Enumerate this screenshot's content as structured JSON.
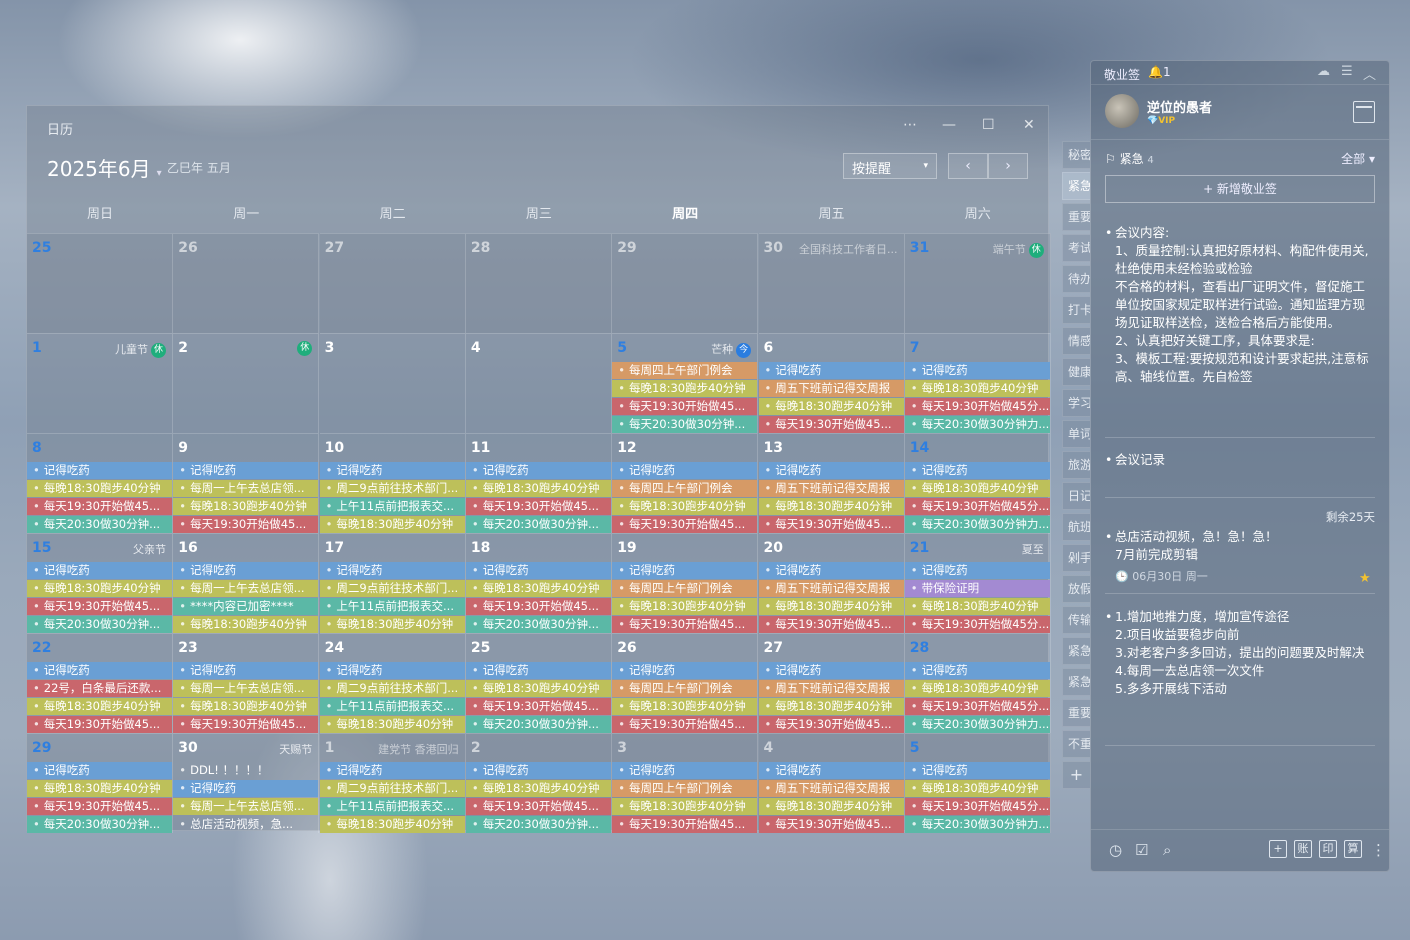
{
  "calendar": {
    "title": "日历",
    "controls": {
      "more": "⋯",
      "minimize": "—",
      "maximize": "☐",
      "close": "✕"
    },
    "month": "2025年6月",
    "month_caret": "▾",
    "lunar": "乙巳年 五月",
    "mode": "按提醒",
    "mode_caret": "▾",
    "prev": "‹",
    "next": "›",
    "weekdays": [
      "周日",
      "周一",
      "周二",
      "周三",
      "周四",
      "周五",
      "周六"
    ],
    "weeks": [
      [
        {
          "d": "25",
          "o": 1,
          "blue": 1
        },
        {
          "d": "26",
          "o": 1
        },
        {
          "d": "27",
          "o": 1
        },
        {
          "d": "28",
          "o": 1
        },
        {
          "d": "29",
          "o": 1
        },
        {
          "d": "30",
          "o": 1,
          "f": "全国科技工作者日..."
        },
        {
          "d": "31",
          "o": 1,
          "blue": 1,
          "f": "端午节",
          "b": "休",
          "bc": "g"
        }
      ],
      [
        {
          "d": "1",
          "blue": 1,
          "f": "儿童节",
          "b": "休",
          "bc": "g"
        },
        {
          "d": "2",
          "b": "休",
          "bc": "g"
        },
        {
          "d": "3"
        },
        {
          "d": "4"
        },
        {
          "d": "5",
          "blue": 1,
          "f": "芒种",
          "b": "今",
          "bc": "b",
          "ev": [
            [
              "每周四上午部门例会",
              "orange"
            ],
            [
              "每晚18:30跑步40分钟",
              "yellow"
            ],
            [
              "每天19:30开始做45...",
              "red"
            ],
            [
              "每天20:30做30分钟...",
              "teal"
            ]
          ]
        },
        {
          "d": "6",
          "ev": [
            [
              "记得吃药",
              "blue"
            ],
            [
              "周五下班前记得交周报",
              "orange"
            ],
            [
              "每晚18:30跑步40分钟",
              "yellow"
            ],
            [
              "每天19:30开始做45...",
              "red"
            ]
          ]
        },
        {
          "d": "7",
          "blue": 1,
          "ev": [
            [
              "记得吃药",
              "blue"
            ],
            [
              "每晚18:30跑步40分钟",
              "yellow"
            ],
            [
              "每天19:30开始做45分...",
              "red"
            ],
            [
              "每天20:30做30分钟力...",
              "teal"
            ]
          ]
        }
      ],
      [
        {
          "d": "8",
          "blue": 1,
          "ev": [
            [
              "记得吃药",
              "blue"
            ],
            [
              "每晚18:30跑步40分钟",
              "yellow"
            ],
            [
              "每天19:30开始做45...",
              "red"
            ],
            [
              "每天20:30做30分钟...",
              "teal"
            ]
          ]
        },
        {
          "d": "9",
          "ev": [
            [
              "记得吃药",
              "blue"
            ],
            [
              "每周一上午去总店领...",
              "yellow"
            ],
            [
              "每晚18:30跑步40分钟",
              "yellow"
            ],
            [
              "每天19:30开始做45...",
              "red"
            ]
          ]
        },
        {
          "d": "10",
          "ev": [
            [
              "记得吃药",
              "blue"
            ],
            [
              "周二9点前往技术部门...",
              "yellow"
            ],
            [
              "上午11点前把报表交...",
              "teal"
            ],
            [
              "每晚18:30跑步40分钟",
              "yellow"
            ]
          ]
        },
        {
          "d": "11",
          "ev": [
            [
              "记得吃药",
              "blue"
            ],
            [
              "每晚18:30跑步40分钟",
              "yellow"
            ],
            [
              "每天19:30开始做45...",
              "red"
            ],
            [
              "每天20:30做30分钟...",
              "teal"
            ]
          ]
        },
        {
          "d": "12",
          "ev": [
            [
              "记得吃药",
              "blue"
            ],
            [
              "每周四上午部门例会",
              "orange"
            ],
            [
              "每晚18:30跑步40分钟",
              "yellow"
            ],
            [
              "每天19:30开始做45...",
              "red"
            ]
          ]
        },
        {
          "d": "13",
          "ev": [
            [
              "记得吃药",
              "blue"
            ],
            [
              "周五下班前记得交周报",
              "orange"
            ],
            [
              "每晚18:30跑步40分钟",
              "yellow"
            ],
            [
              "每天19:30开始做45...",
              "red"
            ]
          ]
        },
        {
          "d": "14",
          "blue": 1,
          "ev": [
            [
              "记得吃药",
              "blue"
            ],
            [
              "每晚18:30跑步40分钟",
              "yellow"
            ],
            [
              "每天19:30开始做45分...",
              "red"
            ],
            [
              "每天20:30做30分钟力...",
              "teal"
            ]
          ]
        }
      ],
      [
        {
          "d": "15",
          "blue": 1,
          "f": "父亲节",
          "ev": [
            [
              "记得吃药",
              "blue"
            ],
            [
              "每晚18:30跑步40分钟",
              "yellow"
            ],
            [
              "每天19:30开始做45...",
              "red"
            ],
            [
              "每天20:30做30分钟...",
              "teal"
            ]
          ]
        },
        {
          "d": "16",
          "ev": [
            [
              "记得吃药",
              "blue"
            ],
            [
              "每周一上午去总店领...",
              "yellow"
            ],
            [
              "****内容已加密****",
              "teal"
            ],
            [
              "每晚18:30跑步40分钟",
              "yellow"
            ]
          ]
        },
        {
          "d": "17",
          "ev": [
            [
              "记得吃药",
              "blue"
            ],
            [
              "周二9点前往技术部门...",
              "yellow"
            ],
            [
              "上午11点前把报表交...",
              "teal"
            ],
            [
              "每晚18:30跑步40分钟",
              "yellow"
            ]
          ]
        },
        {
          "d": "18",
          "ev": [
            [
              "记得吃药",
              "blue"
            ],
            [
              "每晚18:30跑步40分钟",
              "yellow"
            ],
            [
              "每天19:30开始做45...",
              "red"
            ],
            [
              "每天20:30做30分钟...",
              "teal"
            ]
          ]
        },
        {
          "d": "19",
          "ev": [
            [
              "记得吃药",
              "blue"
            ],
            [
              "每周四上午部门例会",
              "orange"
            ],
            [
              "每晚18:30跑步40分钟",
              "yellow"
            ],
            [
              "每天19:30开始做45...",
              "red"
            ]
          ]
        },
        {
          "d": "20",
          "ev": [
            [
              "记得吃药",
              "blue"
            ],
            [
              "周五下班前记得交周报",
              "orange"
            ],
            [
              "每晚18:30跑步40分钟",
              "yellow"
            ],
            [
              "每天19:30开始做45...",
              "red"
            ]
          ]
        },
        {
          "d": "21",
          "blue": 1,
          "f": "夏至",
          "ev": [
            [
              "记得吃药",
              "blue"
            ],
            [
              "带保险证明",
              "purple"
            ],
            [
              "每晚18:30跑步40分钟",
              "yellow"
            ],
            [
              "每天19:30开始做45分...",
              "red"
            ]
          ]
        }
      ],
      [
        {
          "d": "22",
          "blue": 1,
          "ev": [
            [
              "记得吃药",
              "blue"
            ],
            [
              "22号，白条最后还款...",
              "red"
            ],
            [
              "每晚18:30跑步40分钟",
              "yellow"
            ],
            [
              "每天19:30开始做45...",
              "red"
            ]
          ]
        },
        {
          "d": "23",
          "ev": [
            [
              "记得吃药",
              "blue"
            ],
            [
              "每周一上午去总店领...",
              "yellow"
            ],
            [
              "每晚18:30跑步40分钟",
              "yellow"
            ],
            [
              "每天19:30开始做45...",
              "red"
            ]
          ]
        },
        {
          "d": "24",
          "ev": [
            [
              "记得吃药",
              "blue"
            ],
            [
              "周二9点前往技术部门...",
              "yellow"
            ],
            [
              "上午11点前把报表交...",
              "teal"
            ],
            [
              "每晚18:30跑步40分钟",
              "yellow"
            ]
          ]
        },
        {
          "d": "25",
          "ev": [
            [
              "记得吃药",
              "blue"
            ],
            [
              "每晚18:30跑步40分钟",
              "yellow"
            ],
            [
              "每天19:30开始做45...",
              "red"
            ],
            [
              "每天20:30做30分钟...",
              "teal"
            ]
          ]
        },
        {
          "d": "26",
          "ev": [
            [
              "记得吃药",
              "blue"
            ],
            [
              "每周四上午部门例会",
              "orange"
            ],
            [
              "每晚18:30跑步40分钟",
              "yellow"
            ],
            [
              "每天19:30开始做45...",
              "red"
            ]
          ]
        },
        {
          "d": "27",
          "ev": [
            [
              "记得吃药",
              "blue"
            ],
            [
              "周五下班前记得交周报",
              "orange"
            ],
            [
              "每晚18:30跑步40分钟",
              "yellow"
            ],
            [
              "每天19:30开始做45...",
              "red"
            ]
          ]
        },
        {
          "d": "28",
          "blue": 1,
          "ev": [
            [
              "记得吃药",
              "blue"
            ],
            [
              "每晚18:30跑步40分钟",
              "yellow"
            ],
            [
              "每天19:30开始做45分...",
              "red"
            ],
            [
              "每天20:30做30分钟力...",
              "teal"
            ]
          ]
        }
      ],
      [
        {
          "d": "29",
          "blue": 1,
          "ev": [
            [
              "记得吃药",
              "blue"
            ],
            [
              "每晚18:30跑步40分钟",
              "yellow"
            ],
            [
              "每天19:30开始做45...",
              "red"
            ],
            [
              "每天20:30做30分钟...",
              "teal"
            ]
          ]
        },
        {
          "d": "30",
          "f": "天赐节",
          "ev": [
            [
              "DDL! ！！！！",
              "none"
            ],
            [
              "记得吃药",
              "blue"
            ],
            [
              "每周一上午去总店领...",
              "yellow"
            ],
            [
              "总店活动视频，急...",
              "none"
            ]
          ]
        },
        {
          "d": "1",
          "o": 1,
          "f": "建党节 香港回归",
          "ev": [
            [
              "记得吃药",
              "blue"
            ],
            [
              "周二9点前往技术部门...",
              "yellow"
            ],
            [
              "上午11点前把报表交...",
              "teal"
            ],
            [
              "每晚18:30跑步40分钟",
              "yellow"
            ]
          ]
        },
        {
          "d": "2",
          "o": 1,
          "ev": [
            [
              "记得吃药",
              "blue"
            ],
            [
              "每晚18:30跑步40分钟",
              "yellow"
            ],
            [
              "每天19:30开始做45...",
              "red"
            ],
            [
              "每天20:30做30分钟...",
              "teal"
            ]
          ]
        },
        {
          "d": "3",
          "o": 1,
          "ev": [
            [
              "记得吃药",
              "blue"
            ],
            [
              "每周四上午部门例会",
              "orange"
            ],
            [
              "每晚18:30跑步40分钟",
              "yellow"
            ],
            [
              "每天19:30开始做45...",
              "red"
            ]
          ]
        },
        {
          "d": "4",
          "o": 1,
          "ev": [
            [
              "记得吃药",
              "blue"
            ],
            [
              "周五下班前记得交周报",
              "orange"
            ],
            [
              "每晚18:30跑步40分钟",
              "yellow"
            ],
            [
              "每天19:30开始做45...",
              "red"
            ]
          ]
        },
        {
          "d": "5",
          "o": 1,
          "blue": 1,
          "ev": [
            [
              "记得吃药",
              "blue"
            ],
            [
              "每晚18:30跑步40分钟",
              "yellow"
            ],
            [
              "每天19:30开始做45分...",
              "red"
            ],
            [
              "每天20:30做30分钟力...",
              "teal"
            ]
          ]
        }
      ]
    ]
  },
  "panel": {
    "app": "敬业签",
    "bell_count": "1",
    "user": "逆位的愚者",
    "vip": "💎VIP",
    "category": "紧急",
    "category_count": "4",
    "filter": "全部 ▾",
    "new_button": "+ 新增敬业签",
    "notes": [
      {
        "lines": [
          "会议内容:",
          "1、质量控制:认真把好原材料、构配件使用关,杜绝使用未经检验或检验",
          "不合格的材料，查看出厂证明文件，督促施工单位按国家规定取样进行试验。通知监理方现场见证取样送检，送检合格后方能使用。",
          "2、认真把好关键工序，具体要求是:",
          "3、模板工程:要按规范和设计要求起拱,注意标高、轴线位置。先自检签"
        ]
      },
      {
        "lines": [
          "会议记录"
        ]
      },
      {
        "lines": [
          "总店活动视频，急！急！急！",
          "7月前完成剪辑"
        ],
        "date": "06月30日 周一"
      },
      {
        "lines": [
          "1.增加地推力度，增加宣传途径",
          "2.项目收益要稳步向前",
          "3.对老客户多多回访，提出的问题要及时解决",
          "4.每周一去总店领一次文件",
          "5.多多开展线下活动"
        ]
      }
    ],
    "remaining": "剩余25天",
    "footer_buttons": [
      "账",
      "印",
      "算"
    ]
  },
  "side_tabs": [
    "秘密",
    "紧急",
    "重要",
    "考试",
    "待办",
    "打卡",
    "情感",
    "健康",
    "学习",
    "单词",
    "旅游",
    "日记",
    "航班",
    "剁手",
    "放假",
    "传输",
    "紧急",
    "紧急",
    "重要",
    "不重"
  ],
  "colors": {
    "blue": "#6a9fd4",
    "yellow": "#bdc05a",
    "red": "#c9666c",
    "teal": "#5bb8a6",
    "orange": "#d69a66",
    "purple": "#a38ad2",
    "accent": "#2a7de0",
    "holiday": "#1fae7c"
  }
}
